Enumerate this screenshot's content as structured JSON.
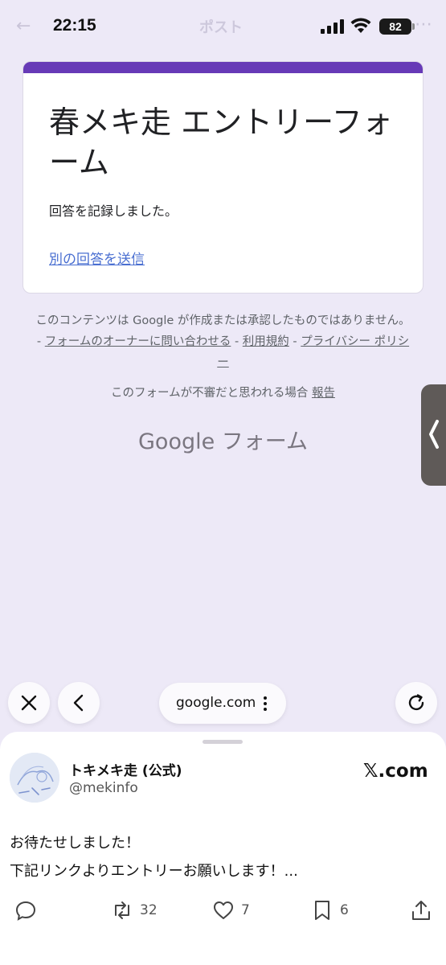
{
  "status_bar": {
    "time": "22:15",
    "battery": "82",
    "faded_title": "ポスト"
  },
  "form": {
    "title": "春メキ走 エントリーフォーム",
    "message": "回答を記録しました。",
    "resubmit_link": "別の回答を送信"
  },
  "disclaimer": {
    "text_before": "このコンテンツは Google が作成または承認したものではありません。 - ",
    "contact_owner": "フォームのオーナーに問い合わせる",
    "sep1": " - ",
    "terms": "利用規約",
    "sep2": " - ",
    "privacy": "プライバシー ポリシー"
  },
  "report": {
    "text": "このフォームが不審だと思われる場合 ",
    "link": "報告"
  },
  "logo": "Google フォーム",
  "browser": {
    "url": "google.com"
  },
  "post": {
    "display_name": "トキメキ走 (公式)",
    "handle": "@mekinfo",
    "site": "𝕏.com",
    "line1": "お待たせしました！",
    "line2": "下記リンクよりエントリーお願いします！...",
    "retweets": "32",
    "likes": "7",
    "bookmarks": "6"
  },
  "colors": {
    "accent": "#673ab7",
    "background": "#ede9f7",
    "link": "#4a6fd1"
  }
}
